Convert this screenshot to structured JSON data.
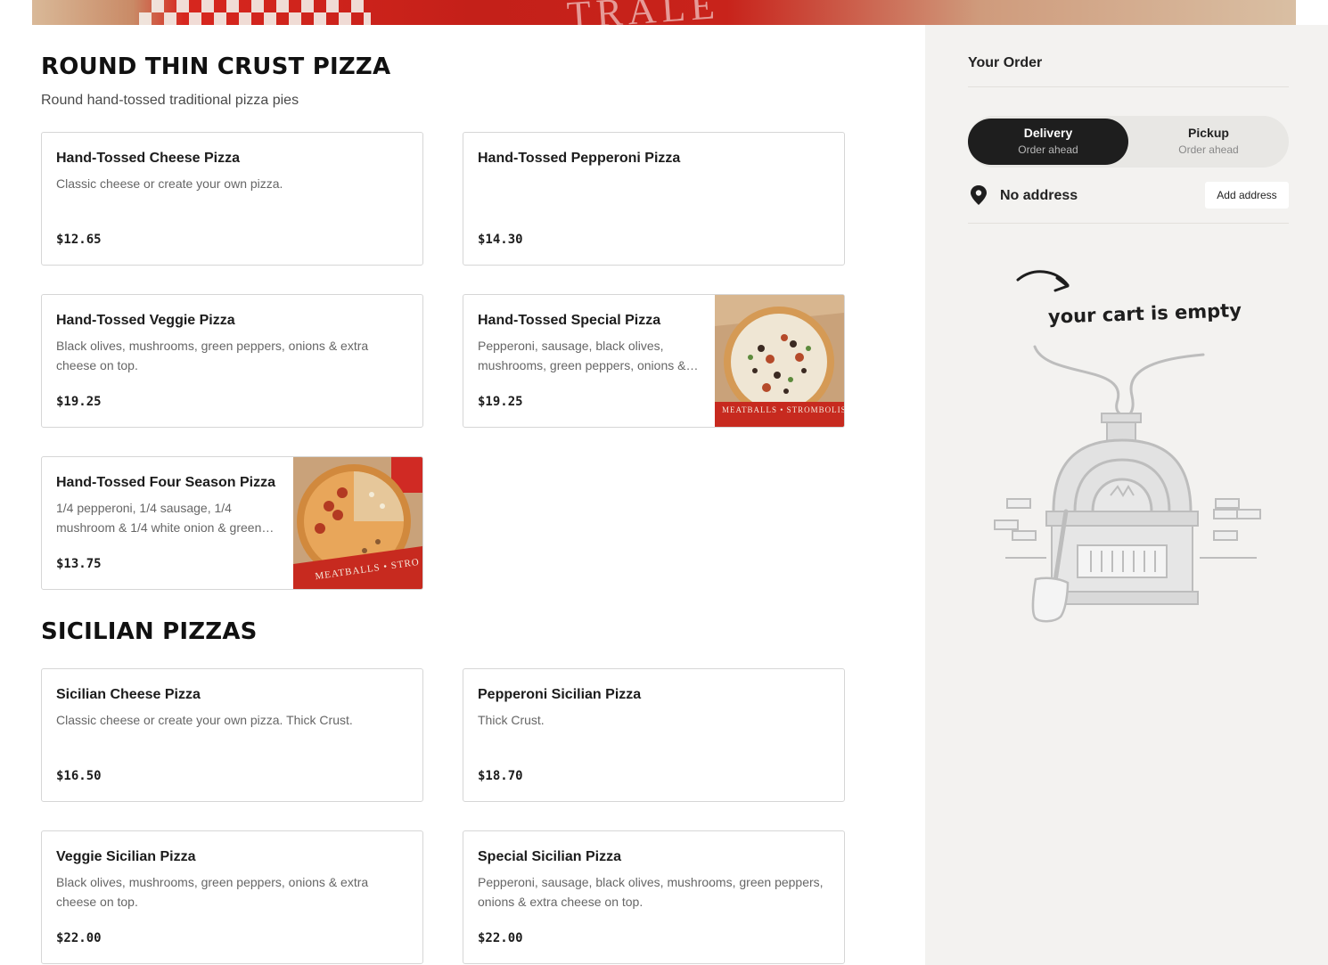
{
  "hero": {
    "watermark_text": "TRALE"
  },
  "sections": [
    {
      "title": "ROUND THIN CRUST PIZZA",
      "subtitle": "Round hand-tossed traditional pizza pies",
      "items": [
        {
          "name": "Hand-Tossed Cheese Pizza",
          "description": "Classic cheese or create your own pizza.",
          "price": "$12.65"
        },
        {
          "name": "Hand-Tossed Pepperoni Pizza",
          "description": "",
          "price": "$14.30"
        },
        {
          "name": "Hand-Tossed Veggie Pizza",
          "description": "Black olives, mushrooms, green peppers, onions & extra cheese on top.",
          "price": "$19.25"
        },
        {
          "name": "Hand-Tossed Special Pizza",
          "description": "Pepperoni, sausage, black olives, mushrooms, green peppers, onions & extra cheese on top.",
          "price": "$19.25",
          "image_text": "MEATBALLS • STROMBOLIS"
        },
        {
          "name": "Hand-Tossed Four Season Pizza",
          "description": "1/4 pepperoni, 1/4 sausage, 1/4 mushroom & 1/4 white onion & green peppers.",
          "price": "$13.75",
          "image_text": "MEATBALLS • STRO"
        }
      ]
    },
    {
      "title": "SICILIAN PIZZAS",
      "items": [
        {
          "name": "Sicilian Cheese Pizza",
          "description": "Classic cheese or create your own pizza. Thick Crust.",
          "price": "$16.50"
        },
        {
          "name": "Pepperoni Sicilian Pizza",
          "description": "Thick Crust.",
          "price": "$18.70"
        },
        {
          "name": "Veggie Sicilian Pizza",
          "description": "Black olives, mushrooms, green peppers, onions & extra cheese on top.",
          "price": "$22.00"
        },
        {
          "name": "Special Sicilian Pizza",
          "description": "Pepperoni, sausage, black olives, mushrooms, green peppers, onions & extra cheese on top.",
          "price": "$22.00"
        }
      ]
    }
  ],
  "order": {
    "title": "Your Order",
    "delivery": {
      "label": "Delivery",
      "sub": "Order ahead",
      "active": true
    },
    "pickup": {
      "label": "Pickup",
      "sub": "Order ahead",
      "active": false
    },
    "address_text": "No address",
    "add_address_label": "Add address",
    "empty_text": "your cart is empty"
  },
  "colors": {
    "toggle_active": "#1e1e1e",
    "sidebar_bg": "#f3f2f0",
    "card_border": "#d6d6d6"
  },
  "icons": {
    "address": "map-pin-icon",
    "empty": "pizza-oven-illustration"
  }
}
